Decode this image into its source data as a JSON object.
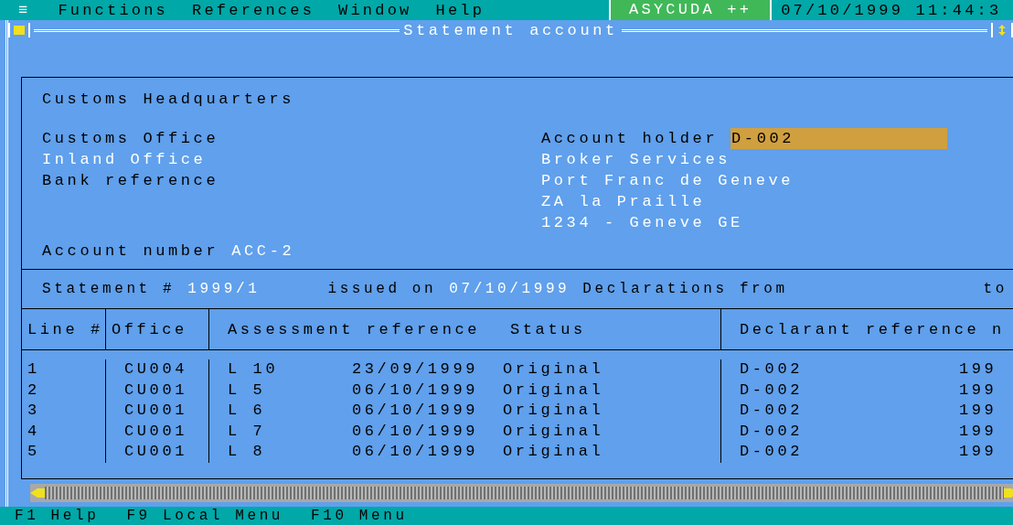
{
  "menu_bar": {
    "menu_icon": "≡",
    "items": [
      "Functions",
      "References",
      "Window",
      "Help"
    ],
    "app_name": "ASYCUDA ++",
    "datetime": "07/10/1999 11:44:3"
  },
  "window": {
    "title": "Statement account"
  },
  "header": {
    "office_title": "Customs Headquarters",
    "left_fields": [
      {
        "label": "Customs Office",
        "value": "Inland Office"
      },
      {
        "label": "Bank reference"
      }
    ],
    "account_holder": {
      "label": "Account holder",
      "value": "D-002"
    },
    "holder_address": [
      "Broker Services",
      "Port Franc de Geneve",
      "ZA la Praille",
      "1234 - Geneve GE"
    ],
    "account_number": {
      "label": "Account number",
      "value": "ACC-2"
    }
  },
  "statement": {
    "label": "Statement #",
    "number": "1999/1",
    "issued_label": "issued on",
    "issued_date": "07/10/1999",
    "from_label": "Declarations from",
    "to_label": "to"
  },
  "table": {
    "columns": [
      "Line #",
      "Office",
      "Assessment reference",
      "Status",
      "Declarant reference n"
    ],
    "rows": [
      {
        "line": "1",
        "office": "CU004",
        "ref": "L 10",
        "date": "23/09/1999",
        "status": "Original",
        "declarant": "D-002",
        "column_6": "199"
      },
      {
        "line": "2",
        "office": "CU001",
        "ref": "L 5",
        "date": "06/10/1999",
        "status": "Original",
        "declarant": "D-002",
        "column_6": "199"
      },
      {
        "line": "3",
        "office": "CU001",
        "ref": "L 6",
        "date": "06/10/1999",
        "status": "Original",
        "declarant": "D-002",
        "column_6": "199"
      },
      {
        "line": "4",
        "office": "CU001",
        "ref": "L 7",
        "date": "06/10/1999",
        "status": "Original",
        "declarant": "D-002",
        "column_6": "199"
      },
      {
        "line": "5",
        "office": "CU001",
        "ref": "L 8",
        "date": "06/10/1999",
        "status": "Original",
        "declarant": "D-002",
        "column_6": "199"
      }
    ]
  },
  "status_bar": [
    "F1 Help",
    "F9 Local Menu",
    "F10 Menu"
  ]
}
